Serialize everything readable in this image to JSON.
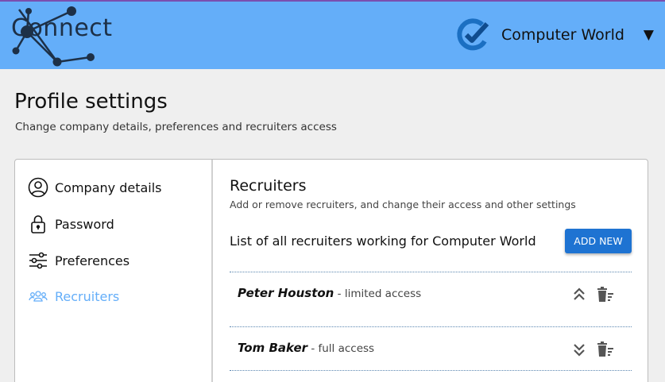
{
  "header": {
    "logo_text": "Connect",
    "company_name": "Computer World",
    "caret": "▼"
  },
  "page": {
    "title": "Profile settings",
    "subtitle": "Change company details, preferences and recruiters access"
  },
  "sidebar": {
    "items": [
      {
        "label": "Company details",
        "icon": "user-circle-icon"
      },
      {
        "label": "Password",
        "icon": "lock-icon"
      },
      {
        "label": "Preferences",
        "icon": "sliders-icon"
      },
      {
        "label": "Recruiters",
        "icon": "users-icon",
        "active": true
      }
    ]
  },
  "recruiters": {
    "title": "Recruiters",
    "subtitle": "Add or remove recruiters, and change their access and other settings",
    "list_title": "List of all recruiters working for Computer World",
    "add_button": "ADD NEW",
    "items": [
      {
        "name": "Peter Houston",
        "access": " - limited access",
        "toggle_icon": "chevrons-up-icon"
      },
      {
        "name": "Tom Baker",
        "access": " - full access",
        "toggle_icon": "chevrons-down-icon"
      }
    ]
  },
  "colors": {
    "header_bg": "#64aef9",
    "accent": "#1e73d2",
    "active_sidebar": "#64aef9"
  }
}
